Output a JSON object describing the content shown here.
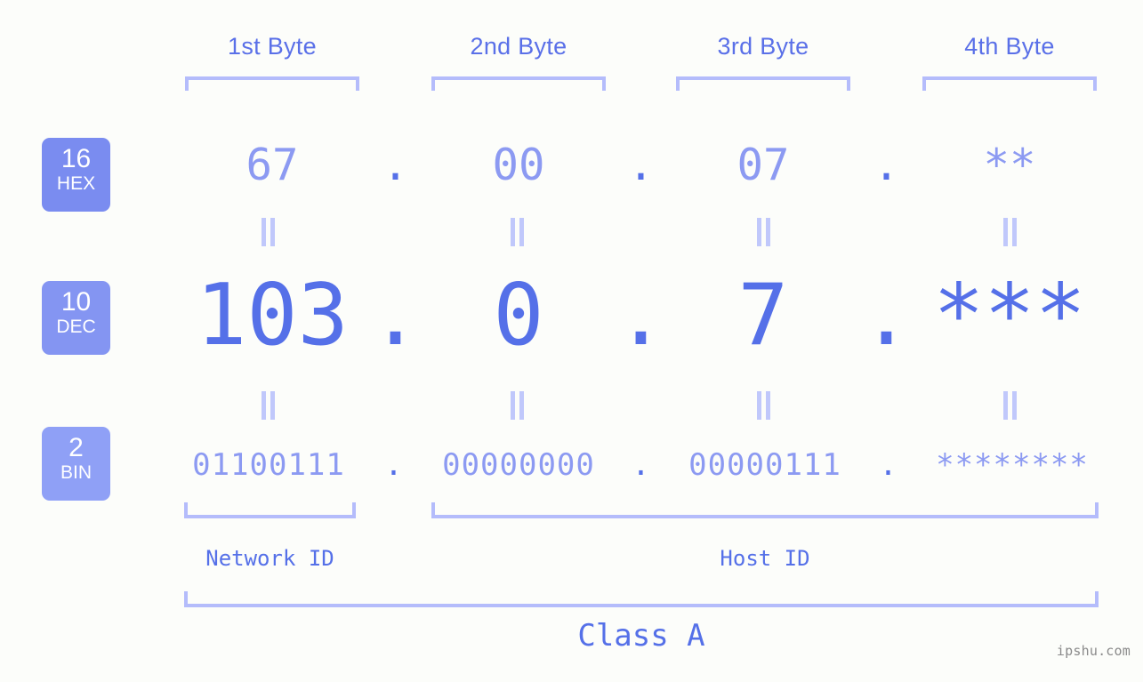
{
  "background_color": "#fcfdfa",
  "accent_color": "#5570e8",
  "muted_accent_color": "#8c9af2",
  "bracket_color": "#b4bcfb",
  "byte_headers": [
    {
      "label": "1st Byte"
    },
    {
      "label": "2nd Byte"
    },
    {
      "label": "3rd Byte"
    },
    {
      "label": "4th Byte"
    }
  ],
  "bases": [
    {
      "number": "16",
      "abbr": "HEX",
      "color": "#7a8cf0"
    },
    {
      "number": "10",
      "abbr": "DEC",
      "color": "#8495f2"
    },
    {
      "number": "2",
      "abbr": "BIN",
      "color": "#8fa0f6"
    }
  ],
  "rows": {
    "hex": {
      "base_number": "16",
      "base_abbr": "HEX",
      "values": [
        "67",
        "00",
        "07",
        "**"
      ],
      "separators": [
        ".",
        ".",
        "."
      ]
    },
    "dec": {
      "base_number": "10",
      "base_abbr": "DEC",
      "values": [
        "103",
        "0",
        "7",
        "***"
      ],
      "separators": [
        ".",
        ".",
        "."
      ]
    },
    "bin": {
      "base_number": "2",
      "base_abbr": "BIN",
      "values": [
        "01100111",
        "00000000",
        "00000111",
        "********"
      ],
      "separators": [
        ".",
        ".",
        "."
      ]
    }
  },
  "equals_symbol": "=",
  "id_sections": [
    {
      "label": "Network ID"
    },
    {
      "label": "Host ID"
    }
  ],
  "class": {
    "label": "Class A"
  },
  "watermark": {
    "text": "ipshu.com"
  }
}
